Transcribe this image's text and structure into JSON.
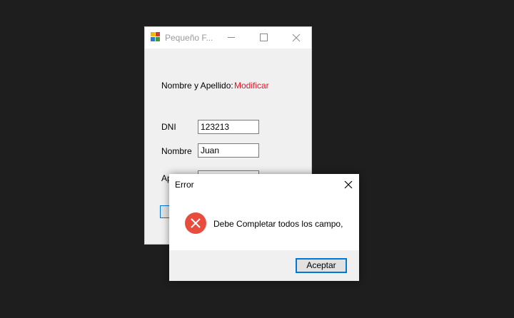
{
  "form": {
    "title": "Pequeño F...",
    "nombre_apellido_label": "Nombre y Apellido:",
    "modificar_text": "Modificar",
    "dni_label": "DNI",
    "dni_value": "123213",
    "nombre_label": "Nombre",
    "nombre_value": "Juan",
    "apellido_label_partial": "Ap"
  },
  "dialog": {
    "title": "Error",
    "message": "Debe Completar todos los campo,",
    "ok_label": "Aceptar"
  },
  "colors": {
    "desktop": "#1e1e1e",
    "modificar_text": "#e81123",
    "error_icon": "#e84c3d",
    "focus_border": "#0078d7"
  },
  "icons": {
    "app": "app-icon",
    "minimize": "minimize-icon",
    "maximize": "maximize-icon",
    "close": "close-icon",
    "error": "error-icon"
  }
}
